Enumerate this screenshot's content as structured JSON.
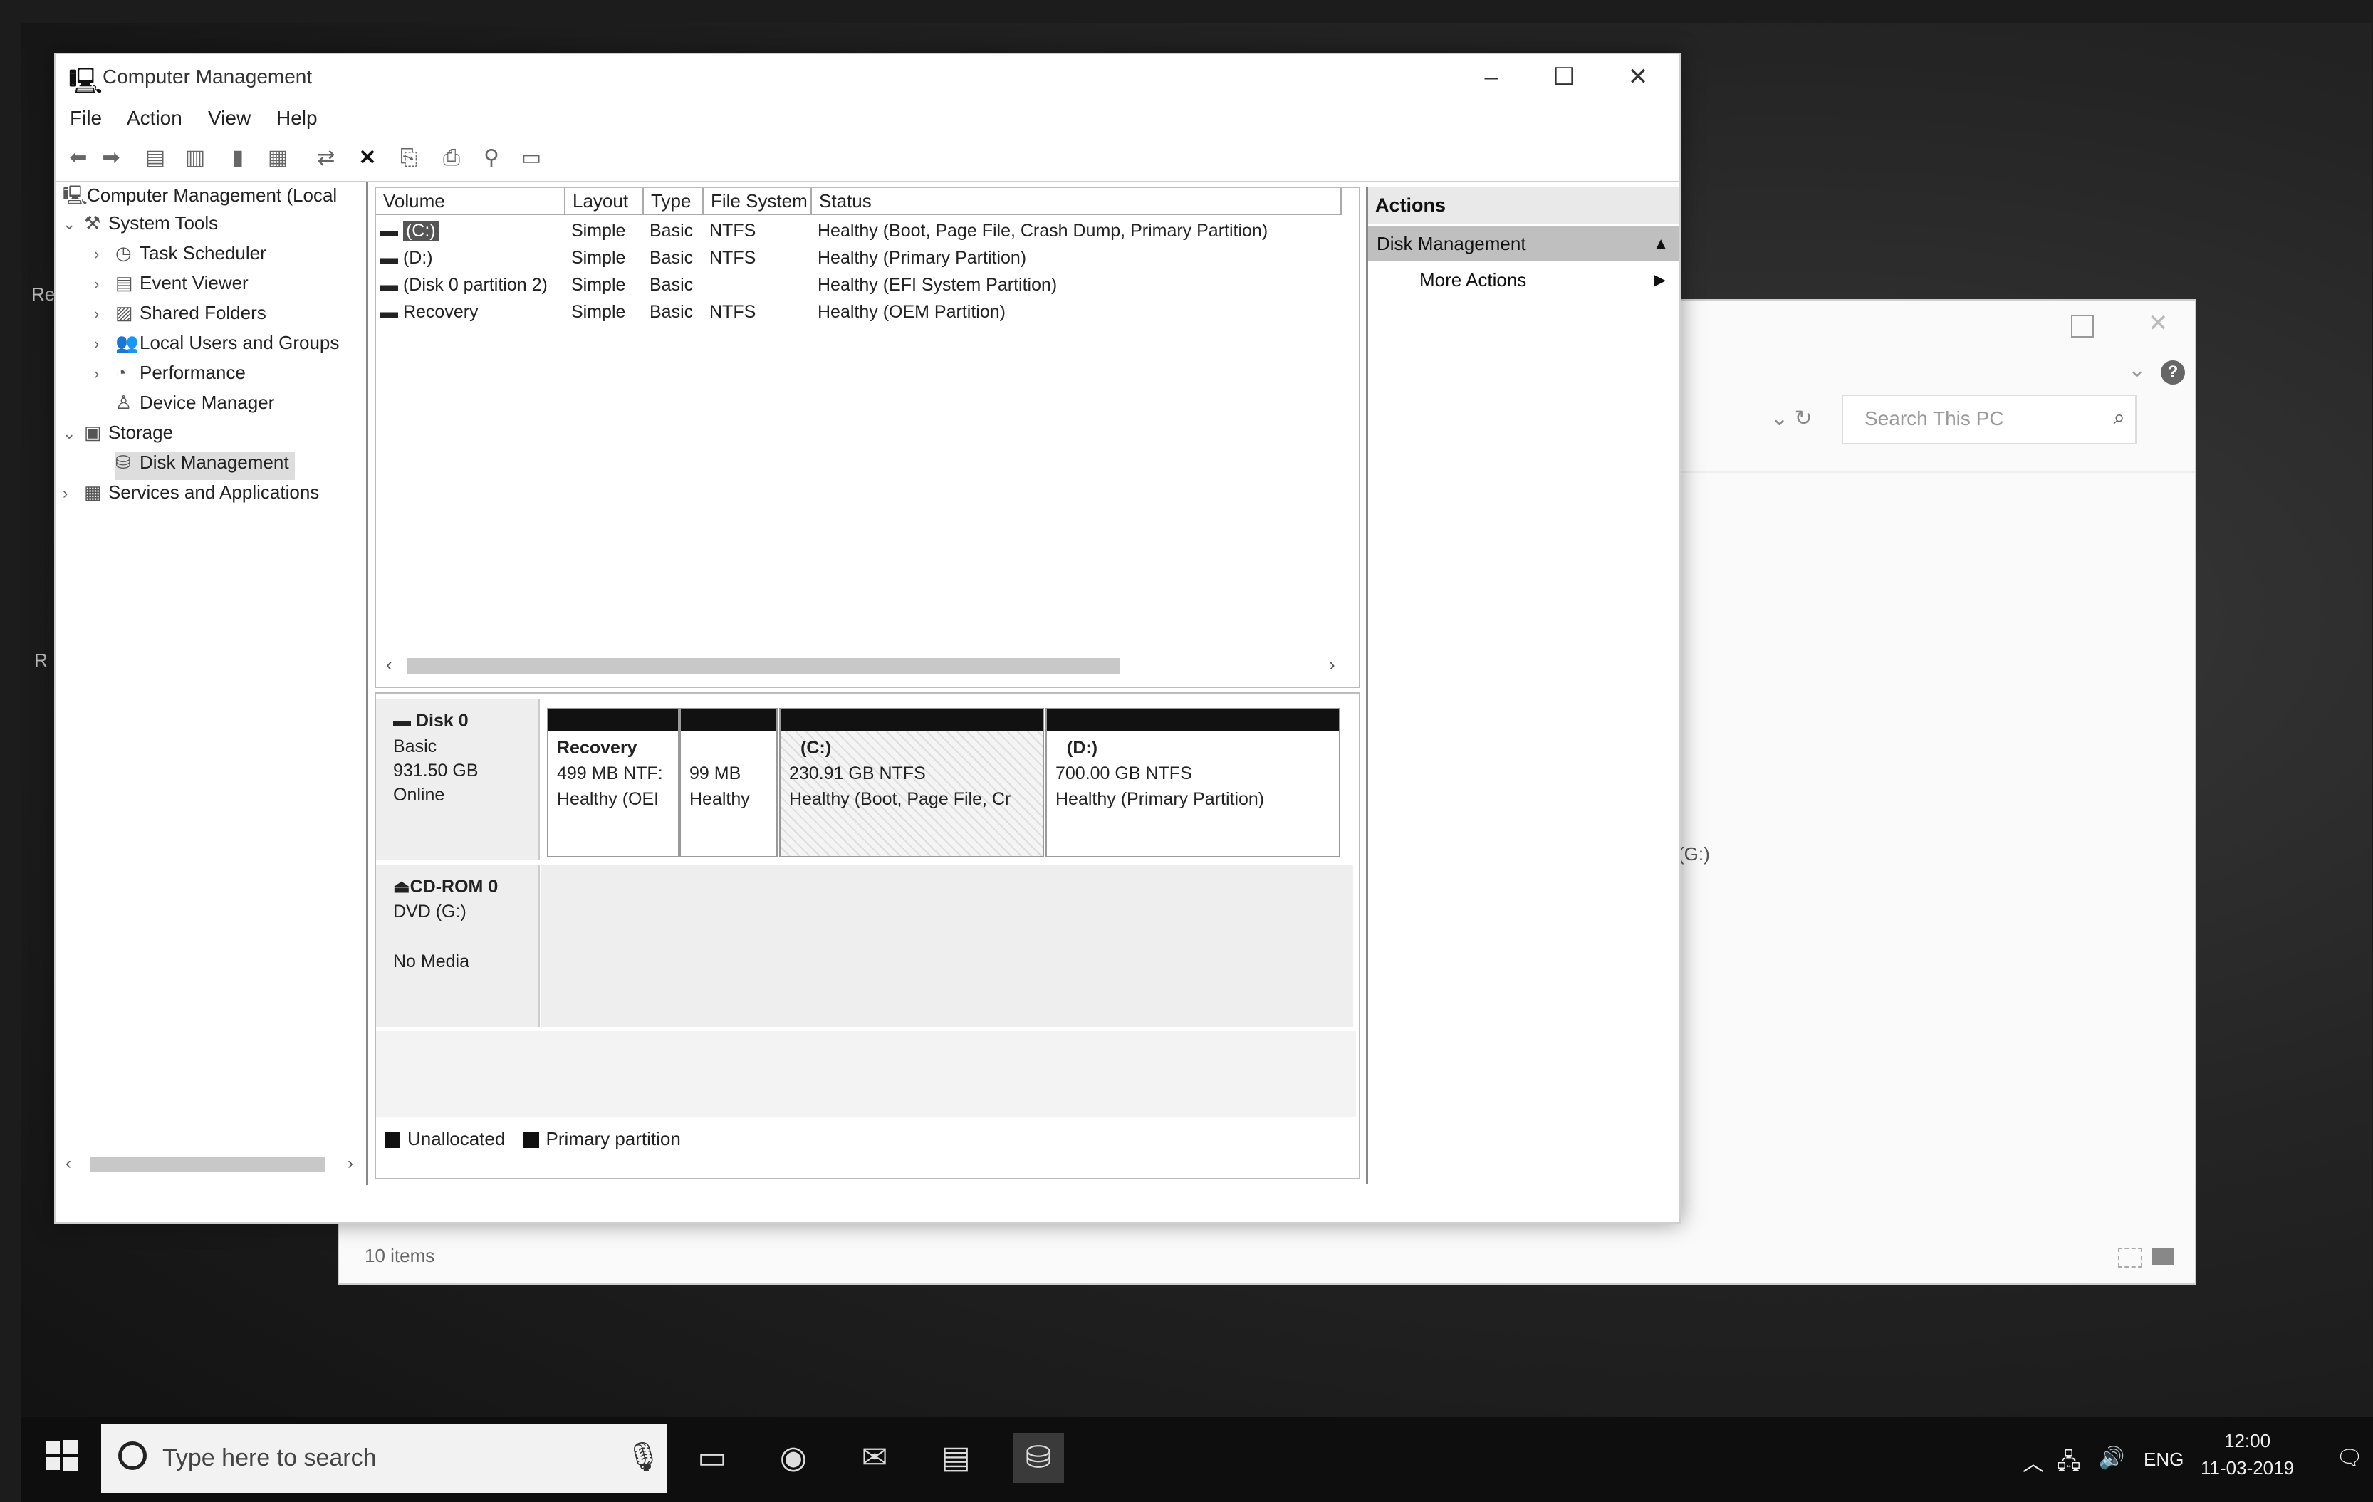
{
  "cm": {
    "title": "Computer Management",
    "menu": [
      "File",
      "Action",
      "View",
      "Help"
    ],
    "tree": [
      {
        "label": "Computer Management (Local",
        "icon": "computer-management-icon",
        "indent": 0,
        "expander": ""
      },
      {
        "label": "System Tools",
        "icon": "system-tools-icon",
        "indent": 1,
        "expander": "v"
      },
      {
        "label": "Task Scheduler",
        "icon": "clock-icon",
        "indent": 2,
        "expander": ">"
      },
      {
        "label": "Event Viewer",
        "icon": "event-viewer-icon",
        "indent": 2,
        "expander": ">"
      },
      {
        "label": "Shared Folders",
        "icon": "shared-folders-icon",
        "indent": 2,
        "expander": ">"
      },
      {
        "label": "Local Users and Groups",
        "icon": "users-icon",
        "indent": 2,
        "expander": ">"
      },
      {
        "label": "Performance",
        "icon": "performance-icon",
        "indent": 2,
        "expander": ">"
      },
      {
        "label": "Device Manager",
        "icon": "device-manager-icon",
        "indent": 2,
        "expander": ""
      },
      {
        "label": "Storage",
        "icon": "storage-icon",
        "indent": 1,
        "expander": "v"
      },
      {
        "label": "Disk Management",
        "icon": "disk-management-icon",
        "indent": 2,
        "expander": "",
        "selected": true
      },
      {
        "label": "Services and Applications",
        "icon": "services-icon",
        "indent": 1,
        "expander": ">"
      }
    ],
    "columns": [
      "Volume",
      "Layout",
      "Type",
      "File System",
      "Status"
    ],
    "volumes": [
      {
        "volume": "(C:)",
        "layout": "Simple",
        "type": "Basic",
        "fs": "NTFS",
        "status": "Healthy (Boot, Page File, Crash Dump, Primary Partition)"
      },
      {
        "volume": "(D:)",
        "layout": "Simple",
        "type": "Basic",
        "fs": "NTFS",
        "status": "Healthy (Primary Partition)"
      },
      {
        "volume": "(Disk 0 partition 2)",
        "layout": "Simple",
        "type": "Basic",
        "fs": "",
        "status": "Healthy (EFI System Partition)"
      },
      {
        "volume": "Recovery",
        "layout": "Simple",
        "type": "Basic",
        "fs": "NTFS",
        "status": "Healthy (OEM Partition)"
      }
    ],
    "disk0": {
      "name": "Disk 0",
      "lines": [
        "Basic",
        "931.50 GB",
        "Online"
      ],
      "partitions": [
        {
          "title": "Recovery",
          "size": "499 MB NTF:",
          "status": "Healthy (OEI"
        },
        {
          "title": "",
          "size": "99 MB",
          "status": "Healthy"
        },
        {
          "title": "(C:)",
          "size": "230.91 GB NTFS",
          "status": "Healthy (Boot, Page File, Cr"
        },
        {
          "title": "(D:)",
          "size": "700.00 GB NTFS",
          "status": "Healthy (Primary Partition)"
        }
      ]
    },
    "cdrom": {
      "name": "CD-ROM 0",
      "lines": [
        "DVD (G:)",
        "",
        "No Media"
      ]
    },
    "legend": [
      "Unallocated",
      "Primary partition"
    ],
    "actions": {
      "header": "Actions",
      "section": "Disk Management",
      "item": "More Actions"
    }
  },
  "explorer": {
    "search_placeholder": "Search This PC",
    "side_text": "(G:)",
    "status": "10 items"
  },
  "taskbar": {
    "search_placeholder": "Type here to search",
    "lang": "ENG",
    "time": "12:00",
    "date": "11-03-2019"
  }
}
